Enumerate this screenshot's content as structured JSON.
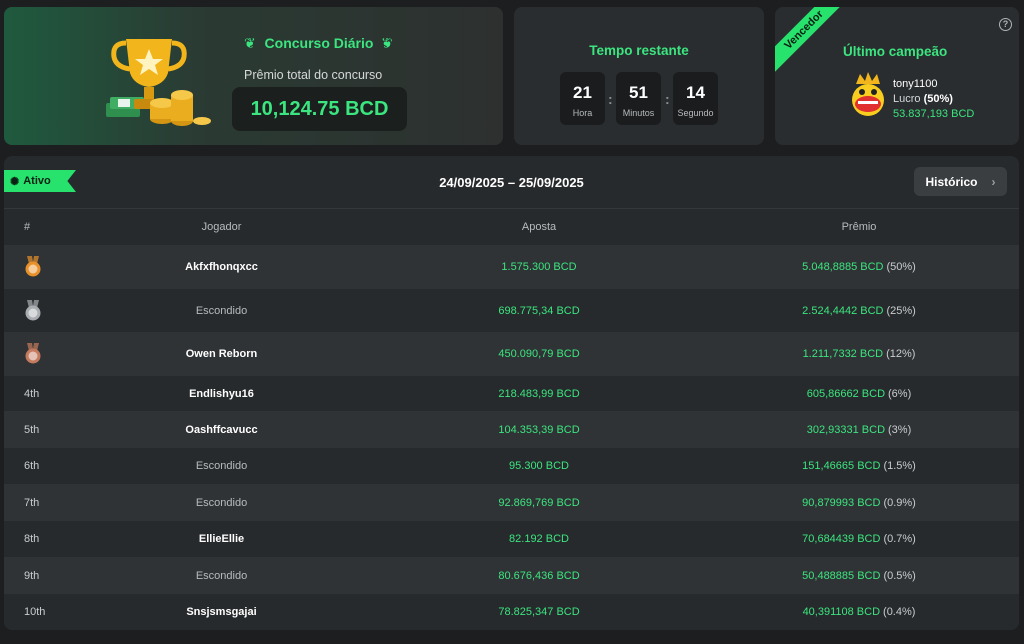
{
  "contest": {
    "title": "Concurso Diário",
    "prize_label": "Prêmio total do concurso",
    "prize_amount": "10,124.75 BCD"
  },
  "timer": {
    "title": "Tempo restante",
    "hours": "21",
    "hours_label": "Hora",
    "minutes": "51",
    "minutes_label": "Minutos",
    "seconds": "14",
    "seconds_label": "Segundo"
  },
  "champion": {
    "ribbon": "Vencedor",
    "title": "Último campeão",
    "name": "tony1100",
    "profit_label": "Lucro",
    "profit_pct": "(50%)",
    "amount": "53.837,193 BCD",
    "help_icon": "question-icon"
  },
  "board": {
    "status": "Ativo",
    "date_range": "24/09/2025 – 25/09/2025",
    "history_label": "Histórico",
    "columns": {
      "rank": "#",
      "player": "Jogador",
      "bet": "Aposta",
      "prize": "Prêmio"
    },
    "rows": [
      {
        "rank": "",
        "medal": "gold",
        "player": "Akfxfhonqxcc",
        "hidden": false,
        "bet": "1.575.300 BCD",
        "prize": "5.048,8885 BCD",
        "pct": "(50%)"
      },
      {
        "rank": "",
        "medal": "silver",
        "player": "Escondido",
        "hidden": true,
        "bet": "698.775,34 BCD",
        "prize": "2.524,4442 BCD",
        "pct": "(25%)"
      },
      {
        "rank": "",
        "medal": "bronze",
        "player": "Owen Reborn",
        "hidden": false,
        "bet": "450.090,79 BCD",
        "prize": "1.211,7332 BCD",
        "pct": "(12%)"
      },
      {
        "rank": "4th",
        "medal": "",
        "player": "Endlishyu16",
        "hidden": false,
        "bet": "218.483,99 BCD",
        "prize": "605,86662 BCD",
        "pct": "(6%)"
      },
      {
        "rank": "5th",
        "medal": "",
        "player": "Oashffcavucc",
        "hidden": false,
        "bet": "104.353,39 BCD",
        "prize": "302,93331 BCD",
        "pct": "(3%)"
      },
      {
        "rank": "6th",
        "medal": "",
        "player": "Escondido",
        "hidden": true,
        "bet": "95.300 BCD",
        "prize": "151,46665 BCD",
        "pct": "(1.5%)"
      },
      {
        "rank": "7th",
        "medal": "",
        "player": "Escondido",
        "hidden": true,
        "bet": "92.869,769 BCD",
        "prize": "90,879993 BCD",
        "pct": "(0.9%)"
      },
      {
        "rank": "8th",
        "medal": "",
        "player": "EllieEllie",
        "hidden": false,
        "bet": "82.192 BCD",
        "prize": "70,684439 BCD",
        "pct": "(0.7%)"
      },
      {
        "rank": "9th",
        "medal": "",
        "player": "Escondido",
        "hidden": true,
        "bet": "80.676,436 BCD",
        "prize": "50,488885 BCD",
        "pct": "(0.5%)"
      },
      {
        "rank": "10th",
        "medal": "",
        "player": "Snsjsmsgajai",
        "hidden": false,
        "bet": "78.825,347 BCD",
        "prize": "40,391108 BCD",
        "pct": "(0.4%)"
      }
    ]
  },
  "colors": {
    "accent": "#3be57f",
    "row_dark": "#272a2c",
    "row_light": "#303335",
    "medal_gold": "#e8902a",
    "medal_silver": "#a9adb1",
    "medal_bronze": "#c47a5e"
  }
}
